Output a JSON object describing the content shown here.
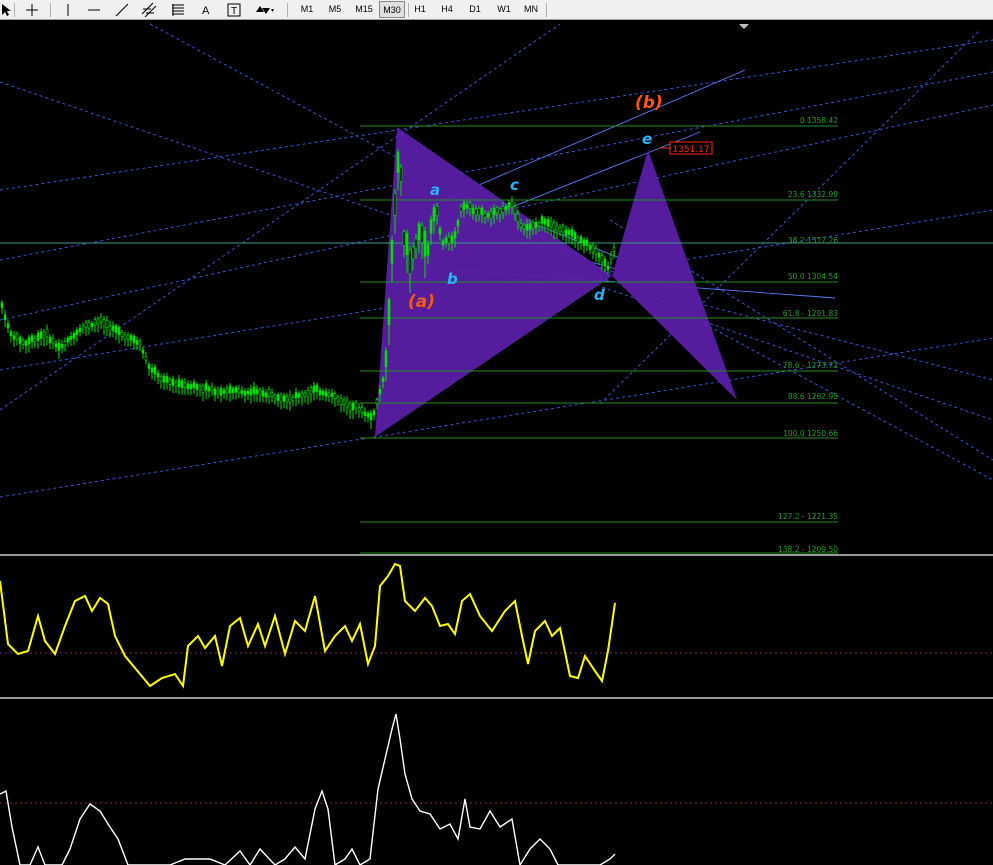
{
  "toolbar": {
    "timeframes": [
      "M1",
      "M5",
      "M15",
      "M30",
      "H1",
      "H4",
      "D1",
      "W1",
      "MN"
    ]
  },
  "chart": {
    "fib_labels": [
      "0 1358.42",
      "23.6 1332.99",
      "38.2 1317.26",
      "50.0 1304.54",
      "61.8 - 1291.83",
      "78.6 - 1273.72",
      "88.6 1262.95",
      "100.0 1250.66",
      "127.2 - 1221.35",
      "138.2 - 1209.50"
    ],
    "price_tag": "1351.17",
    "wave_labels": {
      "a_upper": "(a)",
      "b_upper": "(b)",
      "a": "a",
      "b": "b",
      "c": "c",
      "d": "d",
      "e": "e"
    },
    "colors": {
      "background": "#000000",
      "candles": "#00e000",
      "fib_lines": "#1f8f1f",
      "trend_lines": "#3a5ee6",
      "harmonic_fill": "#5a1fa6",
      "indicator_1": "#ffff00",
      "indicator_2": "#ffffff",
      "level_line": "#b0308a",
      "price_tag": "#ff2b00"
    }
  }
}
